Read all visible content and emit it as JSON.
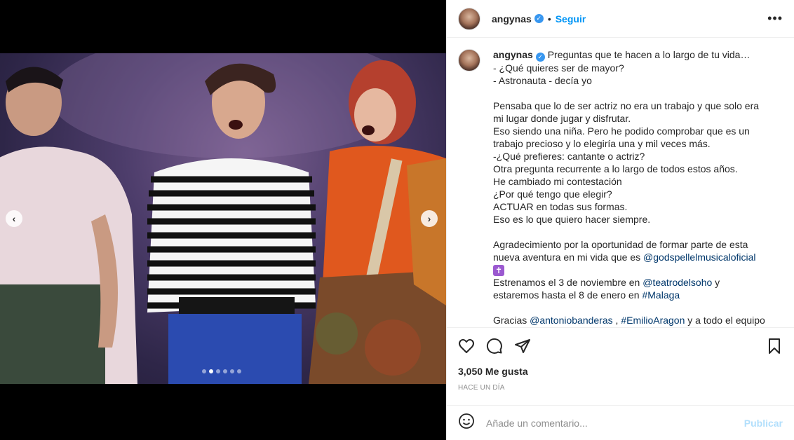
{
  "post": {
    "username": "angynas",
    "follow_label": "Seguir",
    "bullet": "•",
    "more_label": "•••",
    "caption_lines": [
      "- ¿Qué quieres ser de mayor?",
      "- Astronauta - decía yo",
      "",
      "Pensaba que lo de ser actriz no era un trabajo y que solo era",
      "mi lugar donde jugar y disfrutar.",
      "Eso siendo una niña. Pero he podido comprobar que es un",
      "trabajo precioso y lo elegiría una y mil veces más.",
      "-¿Qué prefieres: cantante o actriz?",
      "Otra pregunta recurrente a lo largo de todos estos años.",
      "He cambiado mi contestación",
      "¿Por qué tengo que elegir?",
      "ACTUAR en todas sus formas.",
      "Eso es lo que quiero hacer siempre.",
      "",
      "Agradecimiento por la oportunidad de formar parte de esta"
    ],
    "caption_first": "Preguntas que te hacen a lo largo de tu vida…",
    "line_aventura": "nueva aventura en mi vida que es ",
    "mention_godspell": "@godspellelmusicaloficial",
    "cross_emoji": "✝",
    "line_estrenamos": "Estrenamos el 3 de noviembre en ",
    "mention_teatro": "@teatrodelsoho",
    "line_estrenamos_end": " y",
    "line_estaremos": "estaremos hasta el 8 de enero en ",
    "mention_malaga": "#Malaga",
    "line_gracias": "Gracias ",
    "mention_antonio": "@antoniobanderas",
    "sep_comma": " , ",
    "mention_emilio": "#EmilioAragon",
    "line_gracias_end": " y a todo el equipo",
    "likes": "3,050 Me gusta",
    "time": "HACE UN DÍA",
    "comment_placeholder": "Añade un comentario...",
    "publish_label": "Publicar"
  },
  "carousel": {
    "prev": "‹",
    "next": "›",
    "dot_count": 6,
    "active_index": 1
  },
  "icons": [
    "heart-icon",
    "comment-icon",
    "share-icon",
    "bookmark-icon",
    "emoji-icon",
    "verified-icon"
  ],
  "colors": {
    "accent": "#0095f6",
    "mention": "#00376b",
    "publish_disabled": "#b2dffc"
  }
}
